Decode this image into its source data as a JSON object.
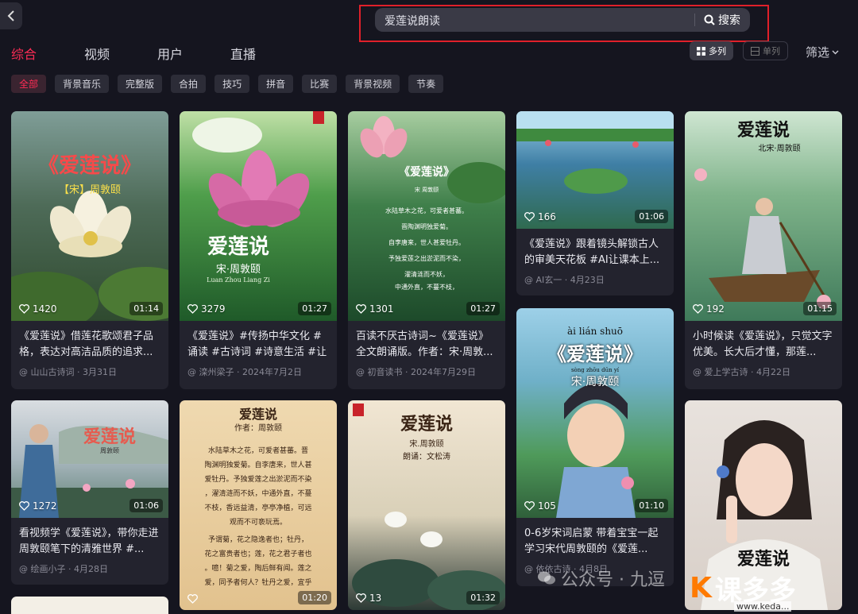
{
  "search": {
    "query": "爱莲说朗读",
    "button_label": "搜索"
  },
  "tabs": [
    {
      "label": "综合",
      "active": true
    },
    {
      "label": "视频",
      "active": false
    },
    {
      "label": "用户",
      "active": false
    },
    {
      "label": "直播",
      "active": false
    }
  ],
  "view_toggle": {
    "multi_label": "多列",
    "single_label": "单列",
    "selected": "多列"
  },
  "filter_label": "筛选",
  "chips": [
    {
      "label": "全部",
      "active": true
    },
    {
      "label": "背景音乐",
      "active": false
    },
    {
      "label": "完整版",
      "active": false
    },
    {
      "label": "合拍",
      "active": false
    },
    {
      "label": "技巧",
      "active": false
    },
    {
      "label": "拼音",
      "active": false
    },
    {
      "label": "比赛",
      "active": false
    },
    {
      "label": "背景视频",
      "active": false
    },
    {
      "label": "节奏",
      "active": false
    }
  ],
  "cards": [
    {
      "likes": "1420",
      "duration": "01:14",
      "title": "《爱莲说》借莲花歌颂君子品格，表达对高洁品质的追求...",
      "author": "@ 山山古诗词",
      "date": "3月31日",
      "overlay": [
        "《爱莲说》",
        "【宋】周敦颐"
      ]
    },
    {
      "likes": "3279",
      "duration": "01:27",
      "title": "《爱莲说》#传扬中华文化 #诵读 #古诗词 #诗意生活 #让阅...",
      "author": "@ 滦州梁子",
      "date": "2024年7月2日",
      "overlay": [
        "爱莲说",
        "宋·周敦颐",
        "Luan Zhou Liang Zi"
      ]
    },
    {
      "likes": "1301",
      "duration": "01:27",
      "title": "百读不厌古诗词~《爱莲说》全文朗诵版。作者：宋·周敦...",
      "author": "@ 初音读书",
      "date": "2024年7月29日",
      "overlay": [
        "《爱莲说》",
        "宋 周敦颐",
        "水陆草木之花，可爱者甚蕃。",
        "晋陶渊明独爱菊。",
        "自李唐来，世人甚爱牡丹。",
        "予独爱莲之出淤泥而不染，",
        "濯清涟而不妖，",
        "中通外直，不蔓不枝，"
      ]
    },
    {
      "likes": "166",
      "duration": "01:06",
      "title": "《爱莲说》跟着镜头解锁古人的审美天花板 #AI让课本上...",
      "author": "@ AI玄一",
      "date": "4月23日",
      "overlay": []
    },
    {
      "likes": "192",
      "duration": "01:15",
      "title": "小时候读《爱莲说》，只觉文字优美。长大后才懂，那莲...",
      "author": "@ 爱上学古诗",
      "date": "4月22日",
      "overlay": [
        "爱莲说",
        "北宋·周敦颐"
      ]
    },
    {
      "likes": "1272",
      "duration": "01:06",
      "title": "看视频学《爱莲说》，带你走进周敦颐笔下的清雅世界 #...",
      "author": "@ 绘画小子",
      "date": "4月28日",
      "overlay": [
        "爱莲说",
        "周敦颐"
      ]
    },
    {
      "likes": "",
      "duration": "01:20",
      "title": "",
      "author": "",
      "date": "",
      "overlay": [
        "爱莲说",
        "作者：周敦颐",
        "水陆草木之花，可爱者甚蕃。晋",
        "陶渊明独爱菊。自李唐来，世人甚",
        "爱牡丹。予独爱莲之出淤泥而不染",
        "，濯清涟而不妖，中通外直，不蔓",
        "不枝，香远益清，亭亭净植，可远",
        "观而不可亵玩焉。",
        "予谓菊，花之隐逸者也；牡丹，",
        "花之富贵者也；莲，花之君子者也",
        "。噫！菊之爱，陶后鲜有闻。莲之",
        "爱，同予者何人？牡丹之爱，宜乎"
      ]
    },
    {
      "likes": "13",
      "duration": "01:32",
      "title": "",
      "author": "",
      "date": "",
      "overlay": [
        "爱莲说",
        "宋.周敦颐",
        "朗诵：文松涛"
      ]
    },
    {
      "likes": "105",
      "duration": "01:10",
      "title": "0-6岁宋词启蒙 带着宝宝一起学习宋代周敦颐的《爱莲...",
      "author": "@ 依依古诗",
      "date": "4月8日",
      "overlay": [
        "ài lián shuō",
        "《爱莲说》",
        "sòng zhōu dūn yí",
        "宋·周敦颐"
      ]
    },
    {
      "likes": "",
      "duration": "",
      "title": "",
      "author": "",
      "date": "",
      "overlay": [
        "爱莲说"
      ]
    }
  ],
  "watermark": {
    "account": "公众号 · 九逗",
    "brand_mark": "K",
    "brand_name": "课多多",
    "url": "www.keda..."
  },
  "colors": {
    "accent": "#fe2c55",
    "background": "#15151f",
    "card": "#23232e",
    "highlight_box": "#e0202a"
  }
}
